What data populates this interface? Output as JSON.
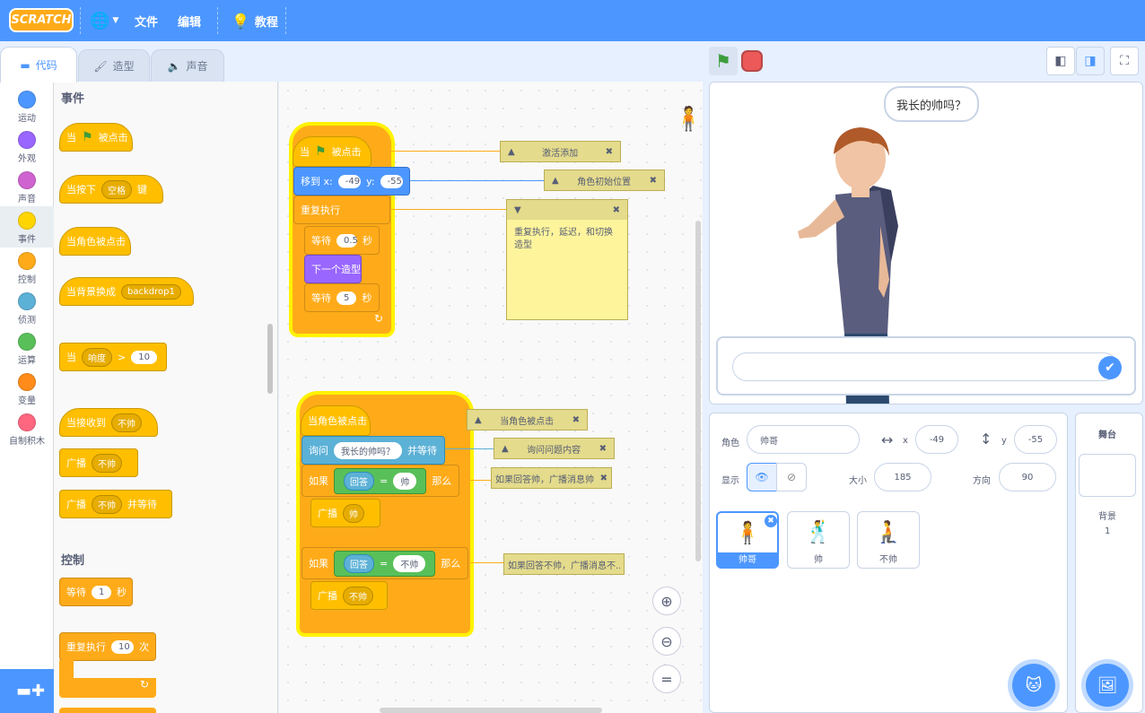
{
  "menu": {
    "logo": "SCRATCH",
    "file": "文件",
    "edit": "编辑",
    "tutorials": "教程"
  },
  "tabs": {
    "code": "代码",
    "costumes": "造型",
    "sounds": "声音"
  },
  "categories": [
    {
      "label": "运动",
      "color": "#4c97ff"
    },
    {
      "label": "外观",
      "color": "#9966ff"
    },
    {
      "label": "声音",
      "color": "#cf63cf"
    },
    {
      "label": "事件",
      "color": "#ffd500"
    },
    {
      "label": "控制",
      "color": "#ffab19"
    },
    {
      "label": "侦测",
      "color": "#5cb1d6"
    },
    {
      "label": "运算",
      "color": "#59c059"
    },
    {
      "label": "变量",
      "color": "#ff8c1a"
    },
    {
      "label": "自制积木",
      "color": "#ff6680"
    }
  ],
  "palette": {
    "events_title": "事件",
    "when_flag": "当",
    "when_flag_clicked": "被点击",
    "when_key": "当按下",
    "key_value": "空格",
    "key_suffix": "键",
    "when_sprite_clicked": "当角色被点击",
    "when_backdrop": "当背景换成",
    "backdrop_value": "backdrop1",
    "when_label": "当",
    "loudness": "响度",
    "gt": ">",
    "loud_value": "10",
    "when_receive": "当接收到",
    "receive_value": "不帅",
    "broadcast": "广播",
    "broadcast_value": "不帅",
    "broadcast_wait": "广播",
    "broadcast_wait_value": "不帅",
    "and_wait": "并等待",
    "control_title": "控制",
    "wait": "等待",
    "wait_value": "1",
    "seconds": "秒",
    "repeat": "重复执行",
    "repeat_value": "10",
    "times": "次"
  },
  "script1": {
    "hat": "当",
    "hat_suffix": "被点击",
    "goto": "移到 x:",
    "x": "-49",
    "y_label": "y:",
    "y": "-55",
    "forever": "重复执行",
    "wait1": "等待",
    "wait1_value": "0.5",
    "sec1": "秒",
    "next_costume": "下一个造型",
    "wait2": "等待",
    "wait2_value": "5",
    "sec2": "秒"
  },
  "script2": {
    "hat": "当角色被点击",
    "ask": "询问",
    "ask_value": "我长的帅吗？",
    "and_wait": "并等待",
    "if1": "如果",
    "answer1": "回答",
    "eq1": "=",
    "val1": "帅",
    "then1": "那么",
    "broadcast1": "广播",
    "bval1": "帅",
    "if2": "如果",
    "answer2": "回答",
    "eq2": "=",
    "val2": "不帅",
    "then2": "那么",
    "broadcast2": "广播",
    "bval2": "不帅"
  },
  "comments": {
    "c1": "激活添加",
    "c2": "角色初始位置",
    "c3": "重复执行，延迟，和切换造型",
    "c4": "当角色被点击",
    "c5": "询问问题内容",
    "c6": "如果回答帅，广播消息帅",
    "c7": "如果回答不帅，广播消息不..."
  },
  "stage": {
    "speech": "我长的帅吗？"
  },
  "sprite_info": {
    "sprite_label": "角色",
    "sprite_name": "帅哥",
    "x_label": "x",
    "x": "-49",
    "y_label": "y",
    "y": "-55",
    "show_label": "显示",
    "size_label": "大小",
    "size": "185",
    "direction_label": "方向",
    "direction": "90"
  },
  "sprites": [
    {
      "name": "帅哥"
    },
    {
      "name": "帅"
    },
    {
      "name": "不帅"
    }
  ],
  "stage_panel": {
    "title": "舞台",
    "backdrop_label": "背景",
    "backdrop_count": "1"
  }
}
